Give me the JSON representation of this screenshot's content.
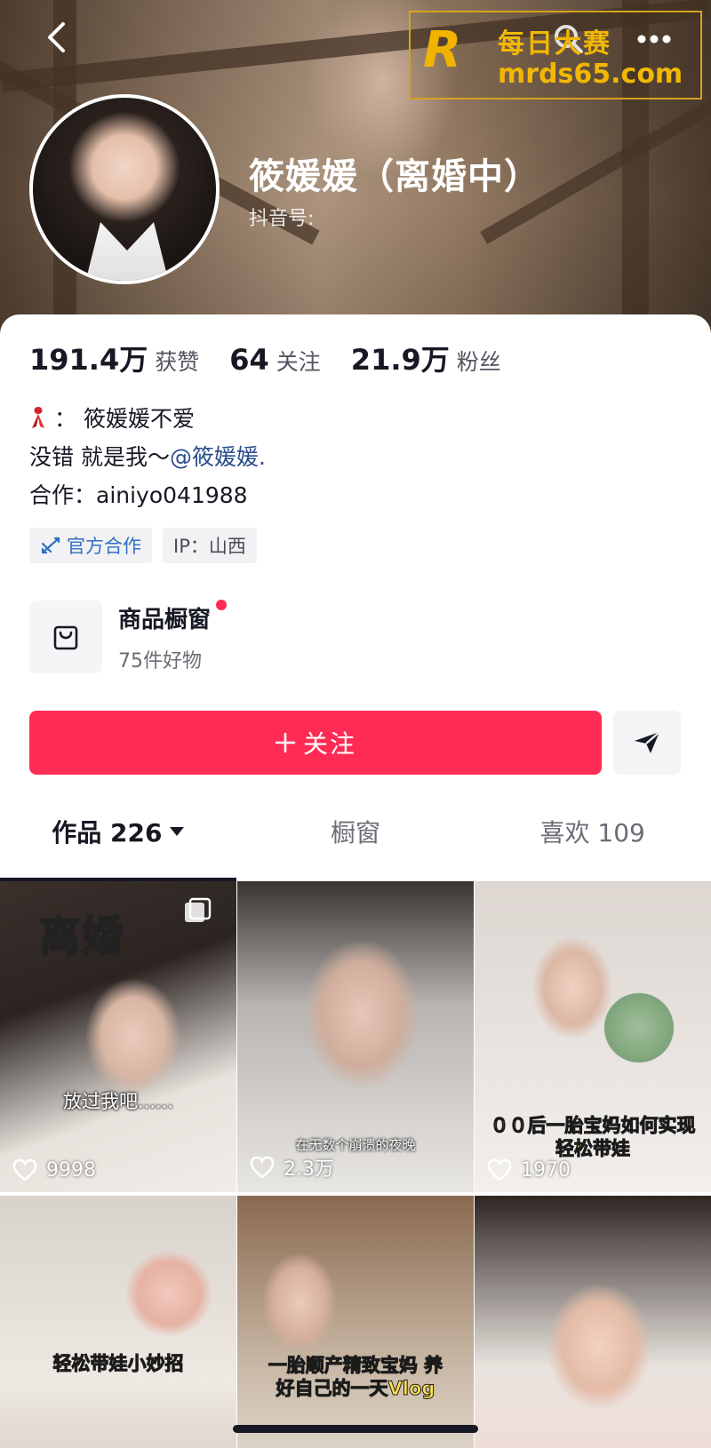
{
  "header": {
    "nickname": "筱媛媛（离婚中）",
    "douyin_id_label": "抖音号:",
    "watermark": {
      "brand_letter": "R",
      "line1": "每日大赛",
      "line2": "mrds65.com"
    }
  },
  "stats": [
    {
      "value": "191.4万",
      "label": "获赞"
    },
    {
      "value": "64",
      "label": "关注"
    },
    {
      "value": "21.9万",
      "label": "粉丝"
    }
  ],
  "bio": {
    "line1_prefix": "：",
    "line1_text": "筱媛媛不爱",
    "line2_text": "没错 就是我～",
    "line2_mention": "@筱媛媛.",
    "line3": "合作：ainiyo041988"
  },
  "tags": {
    "official": "官方合作",
    "ip": "IP：山西"
  },
  "shop": {
    "title": "商品橱窗",
    "subtitle": "75件好物"
  },
  "actions": {
    "follow_label": "关注",
    "follow_color": "#fe2c55"
  },
  "tabs": {
    "works": "作品 226",
    "showcase": "橱窗",
    "likes": "喜欢 109"
  },
  "videos": [
    {
      "overlay": "离婚",
      "caption": "放过我吧......",
      "likes": "9998"
    },
    {
      "caption": "在无数个崩溃的夜晚",
      "likes": "2.3万"
    },
    {
      "caption": "００后一胎宝妈如何实现 轻松带娃",
      "likes": "1970"
    },
    {
      "caption": "轻松带娃小妙招"
    },
    {
      "caption": "一胎顺产精致宝妈 养好自己的一天Vlog"
    },
    {}
  ]
}
